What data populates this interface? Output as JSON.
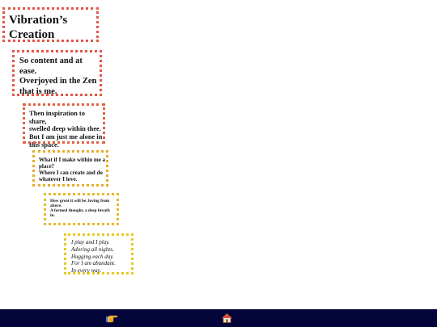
{
  "title": [
    "Vibration’s",
    "Creation"
  ],
  "stanzas": [
    [
      "So content and at",
      "ease.",
      "Overjoyed in the Zen",
      "that is me."
    ],
    [
      "Then inspiration to share,",
      "swelled deep within thee.",
      "But I am just me alone in",
      "this space."
    ],
    [
      "What if I make within me a",
      "place?",
      "Where I can create and do",
      "whatever I love."
    ],
    [
      "How great it will be, loving from",
      "above.",
      "A formed thought, a deep breath",
      "in."
    ],
    [
      "I play and I play.",
      "Adoring all nights.",
      "Hugging each day.",
      "For I am abundant.",
      "In every way."
    ]
  ],
  "toolbar": {
    "next_icon": "pointing-hand-icon",
    "home_icon": "house-icon"
  },
  "colors": {
    "bar_background": "#04053a",
    "border_red": "#e4574a",
    "border_orange": "#e06443",
    "border_amber": "#e8ac2c",
    "border_yellow": "#e8c822"
  }
}
